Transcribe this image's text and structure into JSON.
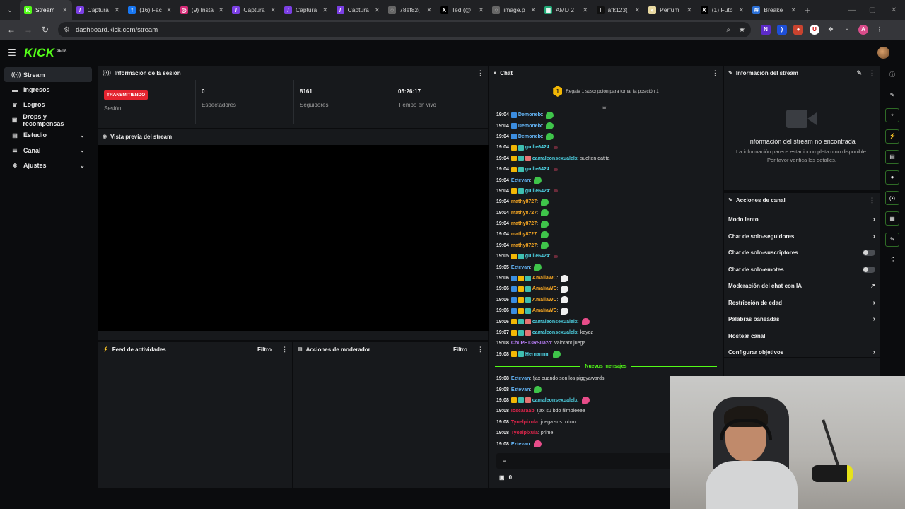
{
  "browser": {
    "tabs": [
      {
        "label": "Stream",
        "fav": "K",
        "color": "#53fc18",
        "active": true
      },
      {
        "label": "Captura",
        "fav": "/",
        "color": "#7b3fe4"
      },
      {
        "label": "(16) Fac",
        "fav": "f",
        "color": "#1877f2"
      },
      {
        "label": "(9) Insta",
        "fav": "◎",
        "color": "#d62976"
      },
      {
        "label": "Captura",
        "fav": "/",
        "color": "#7b3fe4"
      },
      {
        "label": "Captura",
        "fav": "/",
        "color": "#7b3fe4"
      },
      {
        "label": "Captura",
        "fav": "/",
        "color": "#7b3fe4"
      },
      {
        "label": "78ef82(",
        "fav": "◌",
        "color": "#666"
      },
      {
        "label": "Ted (@",
        "fav": "X",
        "color": "#000"
      },
      {
        "label": "image.p",
        "fav": "◌",
        "color": "#666"
      },
      {
        "label": "AMD 2",
        "fav": "▦",
        "color": "#2a7"
      },
      {
        "label": "afk123(",
        "fav": "T",
        "color": "#111"
      },
      {
        "label": "Perfum",
        "fav": "◐",
        "color": "#e8d8a0"
      },
      {
        "label": "(1) Futb",
        "fav": "X",
        "color": "#000"
      },
      {
        "label": "Breake",
        "fav": "≋",
        "color": "#2a6fd6"
      }
    ],
    "url": "dashboard.kick.com/stream",
    "profile_initial": "A"
  },
  "app": {
    "logo": "KICK",
    "logo_badge": "BETA"
  },
  "sidebar": {
    "items": [
      {
        "label": "Stream",
        "icon": "broadcast-icon",
        "glyph": "((•))",
        "active": true,
        "chev": false
      },
      {
        "label": "Ingresos",
        "icon": "wallet-icon",
        "glyph": "▬",
        "chev": false
      },
      {
        "label": "Logros",
        "icon": "trophy-icon",
        "glyph": "♛",
        "chev": false
      },
      {
        "label": "Drops y recompensas",
        "icon": "gift-icon",
        "glyph": "▣",
        "chev": false
      },
      {
        "label": "Estudio",
        "icon": "film-icon",
        "glyph": "▤",
        "chev": true
      },
      {
        "label": "Canal",
        "icon": "channel-icon",
        "glyph": "☰",
        "chev": true
      },
      {
        "label": "Ajustes",
        "icon": "gear-icon",
        "glyph": "✱",
        "chev": true
      }
    ]
  },
  "session": {
    "title": "Información de la sesión",
    "status_badge": "TRANSMITIENDO",
    "status_label": "Sesión",
    "viewers_value": "0",
    "viewers_label": "Espectadores",
    "followers_value": "8161",
    "followers_label": "Seguidores",
    "time_value": "05:26:17",
    "time_label": "Tiempo en vivo"
  },
  "preview": {
    "title": "Vista previa del stream"
  },
  "feed": {
    "title": "Feed de actividades",
    "filter": "Filtro"
  },
  "modactions": {
    "title": "Acciones de moderador",
    "filter": "Filtro"
  },
  "chat": {
    "title": "Chat",
    "banner_rank": "1",
    "banner_text": "Regala 1 suscripción para tomar la posición 1",
    "new_messages": "Nuevos mensajes",
    "coin_count": "0",
    "messages": [
      {
        "time": "19:04",
        "badges": [
          "#3b8de0"
        ],
        "user": "Demonelx",
        "color": "#64b5f6",
        "text": "",
        "emote": "green"
      },
      {
        "time": "19:04",
        "badges": [
          "#3b8de0"
        ],
        "user": "Demonelx",
        "color": "#64b5f6",
        "text": "",
        "emote": "green"
      },
      {
        "time": "19:04",
        "badges": [
          "#3b8de0"
        ],
        "user": "Demonelx",
        "color": "#64b5f6",
        "text": "",
        "emote": "green"
      },
      {
        "time": "19:04",
        "badges": [
          "#f2b705",
          "#3fbfb0"
        ],
        "user": "guille6424",
        "color": "#4dd0e1",
        "text": "",
        "emote": "dark"
      },
      {
        "time": "19:04",
        "badges": [
          "#f2b705",
          "#3fbfb0",
          "#e57373"
        ],
        "user": "camaleonsexualelx",
        "color": "#4dd0e1",
        "text": "suelten datita",
        "emote": ""
      },
      {
        "time": "19:04",
        "badges": [
          "#f2b705",
          "#3fbfb0"
        ],
        "user": "guille6424",
        "color": "#4dd0e1",
        "text": "",
        "emote": "dark"
      },
      {
        "time": "19:04",
        "badges": [],
        "user": "Eztevan",
        "color": "#64b5f6",
        "text": "",
        "emote": "green"
      },
      {
        "time": "19:04",
        "badges": [
          "#f2b705",
          "#3fbfb0"
        ],
        "user": "guille6424",
        "color": "#4dd0e1",
        "text": "",
        "emote": "dark"
      },
      {
        "time": "19:04",
        "badges": [],
        "user": "mathy8727",
        "color": "#f5a623",
        "text": "",
        "emote": "green"
      },
      {
        "time": "19:04",
        "badges": [],
        "user": "mathy8727",
        "color": "#f5a623",
        "text": "",
        "emote": "green"
      },
      {
        "time": "19:04",
        "badges": [],
        "user": "mathy8727",
        "color": "#f5a623",
        "text": "",
        "emote": "green"
      },
      {
        "time": "19:04",
        "badges": [],
        "user": "mathy8727",
        "color": "#f5a623",
        "text": "",
        "emote": "green"
      },
      {
        "time": "19:04",
        "badges": [],
        "user": "mathy8727",
        "color": "#f5a623",
        "text": "",
        "emote": "green"
      },
      {
        "time": "19:05",
        "badges": [
          "#f2b705",
          "#3fbfb0"
        ],
        "user": "guille6424",
        "color": "#4dd0e1",
        "text": "",
        "emote": "dark"
      },
      {
        "time": "19:05",
        "badges": [],
        "user": "Eztevan",
        "color": "#64b5f6",
        "text": "",
        "emote": "green"
      },
      {
        "time": "19:06",
        "badges": [
          "#3b8de0",
          "#f2b705",
          "#3fbfb0"
        ],
        "user": "AmaliaWC",
        "color": "#f5a623",
        "text": "",
        "emote": "white"
      },
      {
        "time": "19:06",
        "badges": [
          "#3b8de0",
          "#f2b705",
          "#3fbfb0"
        ],
        "user": "AmaliaWC",
        "color": "#f5a623",
        "text": "",
        "emote": "white"
      },
      {
        "time": "19:06",
        "badges": [
          "#3b8de0",
          "#f2b705",
          "#3fbfb0"
        ],
        "user": "AmaliaWC",
        "color": "#f5a623",
        "text": "",
        "emote": "white"
      },
      {
        "time": "19:06",
        "badges": [
          "#3b8de0",
          "#f2b705",
          "#3fbfb0"
        ],
        "user": "AmaliaWC",
        "color": "#f5a623",
        "text": "",
        "emote": "white"
      },
      {
        "time": "19:06",
        "badges": [
          "#f2b705",
          "#3fbfb0",
          "#e57373"
        ],
        "user": "camaleonsexualelx",
        "color": "#4dd0e1",
        "text": "",
        "emote": "pink"
      },
      {
        "time": "19:07",
        "badges": [
          "#f2b705",
          "#3fbfb0",
          "#e57373"
        ],
        "user": "camaleonsexualelx",
        "color": "#4dd0e1",
        "text": "kayoz",
        "emote": ""
      },
      {
        "time": "19:08",
        "badges": [],
        "user": "ChuPET3RSuazo",
        "color": "#b57cf2",
        "text": "Valorant juega",
        "emote": ""
      },
      {
        "time": "19:08",
        "badges": [
          "#f2b705",
          "#3fbfb0"
        ],
        "user": "Hernannn",
        "color": "#4dd0e1",
        "text": "",
        "emote": "green"
      }
    ],
    "new_msgs": [
      {
        "time": "19:08",
        "badges": [],
        "user": "Eztevan",
        "color": "#64b5f6",
        "text": "!jax cuando son los piggyawards",
        "emote": ""
      },
      {
        "time": "19:08",
        "badges": [],
        "user": "Eztevan",
        "color": "#64b5f6",
        "text": "",
        "emote": "green"
      },
      {
        "time": "19:08",
        "badges": [
          "#f2b705",
          "#3fbfb0",
          "#e57373"
        ],
        "user": "camaleonsexualelx",
        "color": "#4dd0e1",
        "text": "",
        "emote": "pink"
      },
      {
        "time": "19:08",
        "badges": [],
        "user": "Ioscaraab",
        "color": "#e0254b",
        "text": "!jax su bdo ñimpleeee",
        "emote": ""
      },
      {
        "time": "19:08",
        "badges": [],
        "user": "Tyoelpixula",
        "color": "#e0254b",
        "text": "juega sus roblox",
        "emote": ""
      },
      {
        "time": "19:08",
        "badges": [],
        "user": "Tyoelpixula",
        "color": "#e0254b",
        "text": "prime",
        "emote": ""
      },
      {
        "time": "19:08",
        "badges": [],
        "user": "Eztevan",
        "color": "#64b5f6",
        "text": "",
        "emote": "pink"
      }
    ]
  },
  "streaminfo": {
    "title": "Información del stream",
    "empty_title": "Información del stream no encontrada",
    "empty_sub1": "La información parece estar incompleta o no disponible.",
    "empty_sub2": "Por favor verifica los detalles."
  },
  "actions": {
    "title": "Acciones de canal",
    "rows": [
      {
        "label": "Modo lento",
        "kind": "arrow"
      },
      {
        "label": "Chat de solo-seguidores",
        "kind": "arrow"
      },
      {
        "label": "Chat de solo-suscriptores",
        "kind": "toggle"
      },
      {
        "label": "Chat de solo-emotes",
        "kind": "toggle"
      },
      {
        "label": "Moderación del chat con IA",
        "kind": "ext"
      },
      {
        "label": "Restricción de edad",
        "kind": "arrow"
      },
      {
        "label": "Palabras baneadas",
        "kind": "arrow"
      },
      {
        "label": "Hostear canal",
        "kind": "none"
      },
      {
        "label": "Configurar objetivos",
        "kind": "arrow"
      }
    ]
  }
}
